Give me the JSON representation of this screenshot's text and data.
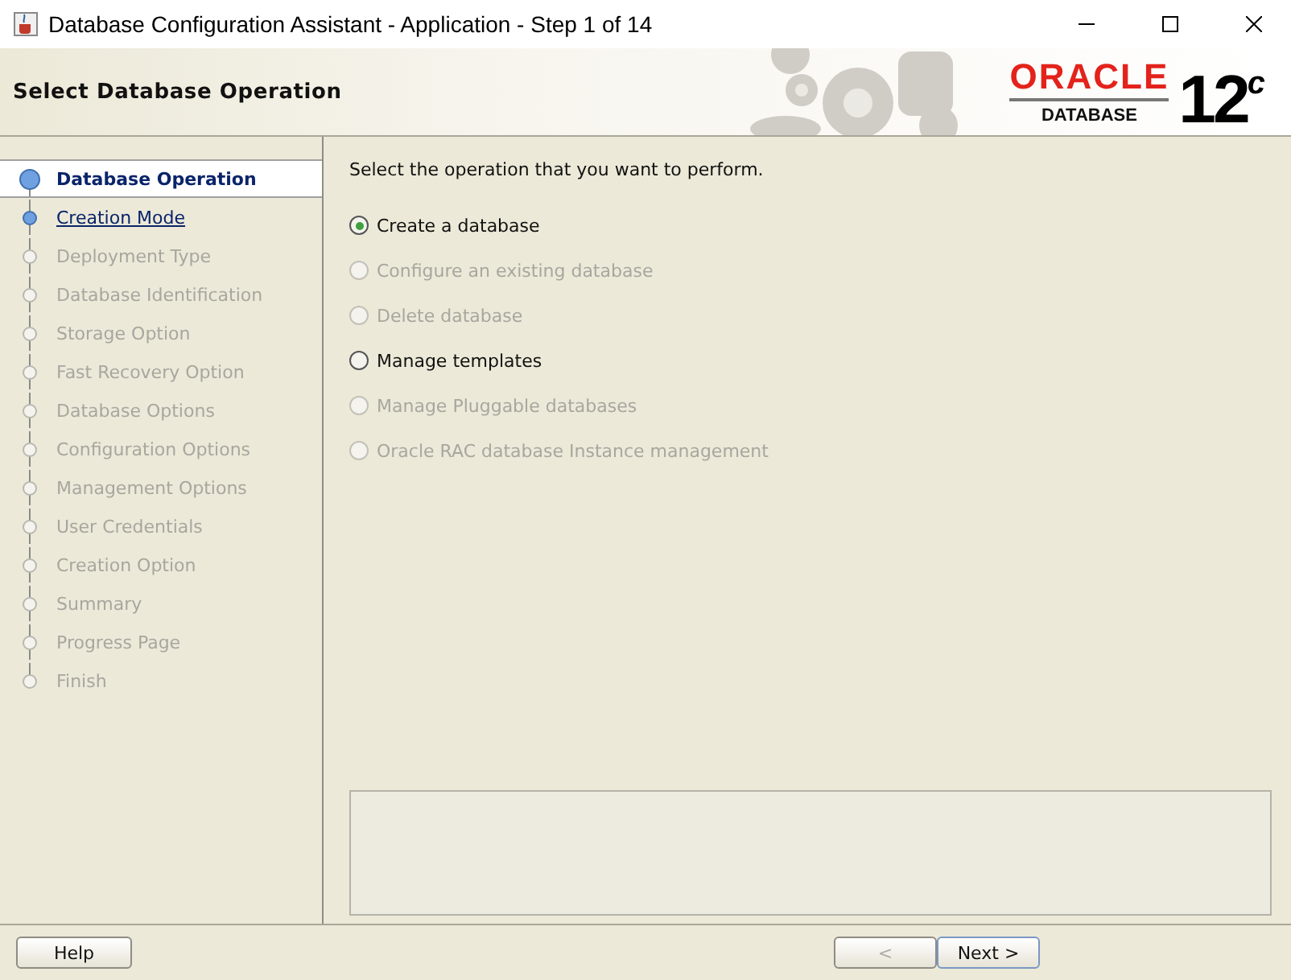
{
  "window": {
    "title": "Database Configuration Assistant - Application - Step 1 of 14"
  },
  "header": {
    "title": "Select Database Operation",
    "logo": {
      "brand": "ORACLE",
      "product": "DATABASE",
      "version": "12$^{c}$"
    }
  },
  "steps": [
    {
      "label": "Database Operation",
      "selected": true,
      "disabled": false
    },
    {
      "label": "Creation Mode",
      "selected": false,
      "disabled": false
    },
    {
      "label": "Deployment Type",
      "selected": false,
      "disabled": true
    },
    {
      "label": "Database Identification",
      "selected": false,
      "disabled": true
    },
    {
      "label": "Storage Option",
      "selected": false,
      "disabled": true
    },
    {
      "label": "Fast Recovery Option",
      "selected": false,
      "disabled": true
    },
    {
      "label": "Database Options",
      "selected": false,
      "disabled": true
    },
    {
      "label": "Configuration Options",
      "selected": false,
      "disabled": true
    },
    {
      "label": "Management Options",
      "selected": false,
      "disabled": true
    },
    {
      "label": "User Credentials",
      "selected": false,
      "disabled": true
    },
    {
      "label": "Creation Option",
      "selected": false,
      "disabled": true
    },
    {
      "label": "Summary",
      "selected": false,
      "disabled": true
    },
    {
      "label": "Progress Page",
      "selected": false,
      "disabled": true
    },
    {
      "label": "Finish",
      "selected": false,
      "disabled": true
    }
  ],
  "prompt": "Select the operation that you want to perform.",
  "operations": [
    {
      "label": "Create a database",
      "selected": true,
      "disabled": false
    },
    {
      "label": "Configure an existing database",
      "selected": false,
      "disabled": true
    },
    {
      "label": "Delete database",
      "selected": false,
      "disabled": true
    },
    {
      "label": "Manage templates",
      "selected": false,
      "disabled": false
    },
    {
      "label": "Manage Pluggable databases",
      "selected": false,
      "disabled": true
    },
    {
      "label": "Oracle RAC database Instance management",
      "selected": false,
      "disabled": true
    }
  ],
  "buttons": {
    "help": {
      "label": "Help"
    },
    "back": {
      "label": "<",
      "disabled": true
    },
    "next": {
      "label": "Next >",
      "disabled": false
    }
  }
}
